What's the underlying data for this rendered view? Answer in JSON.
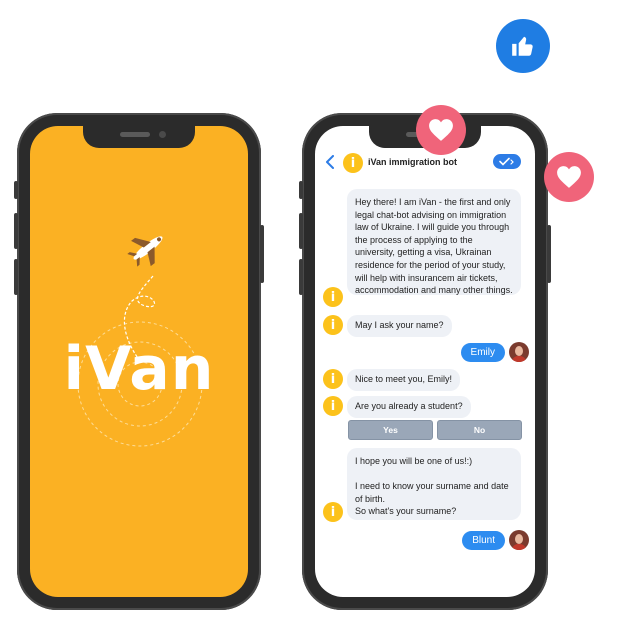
{
  "splash": {
    "logo_text": "iVan",
    "background_color": "#fbb123",
    "icon": "airplane-icon"
  },
  "chat": {
    "header": {
      "back_icon": "chevron-left-icon",
      "bot_name": "iVan immigration bot",
      "bot_avatar_letter": "i",
      "status_icon": "check-icon"
    },
    "messages": [
      {
        "from": "bot",
        "text": "Hey there! I am iVan - the first and only legal chat-bot advising on immigration law of Ukraine. I will guide you through the process of applying to the university, getting a visa, Ukrainan residence for the period of your study, will help with insurancem air tickets, accommodation and many other things."
      },
      {
        "from": "bot",
        "text": "May I ask your name?"
      },
      {
        "from": "user",
        "text": "Emily"
      },
      {
        "from": "bot",
        "text": "Nice to meet you, Emily!"
      },
      {
        "from": "bot",
        "text": "Are you already a student?"
      },
      {
        "from": "bot",
        "text": "I hope you will be one of us!:)\n\nI need to know your surname and date of birth.\nSo what's your surname?"
      },
      {
        "from": "user",
        "text": "Blunt"
      }
    ],
    "quick_replies": [
      "Yes",
      "No"
    ]
  },
  "reactions": {
    "like_icon": "thumbs-up-icon",
    "heart_icon": "heart-icon"
  },
  "colors": {
    "accent_blue": "#2d7ce6",
    "bot_yellow": "#fcc21b",
    "heart_pink": "#f0647a",
    "like_blue": "#1f7de3"
  }
}
